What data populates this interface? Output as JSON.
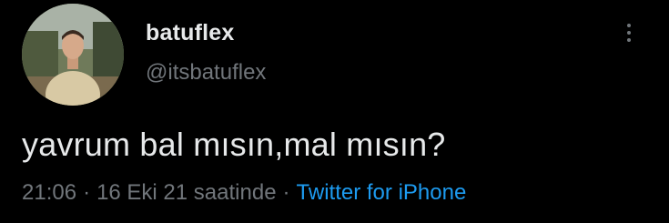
{
  "author": {
    "display_name": "batuflex",
    "handle": "@itsbatuflex",
    "avatar_icon": "profile-photo-avatar"
  },
  "more_menu_icon": "more-vertical-icon",
  "tweet": {
    "text": "yavrum bal mısın,mal mısın?",
    "time": "21:06",
    "date": "16 Eki 21 saatinde",
    "separator": "·",
    "source": "Twitter for iPhone"
  },
  "colors": {
    "background": "#000000",
    "primary_text": "#e7e9ea",
    "secondary_text": "#71767b",
    "link": "#1d9bf0"
  }
}
